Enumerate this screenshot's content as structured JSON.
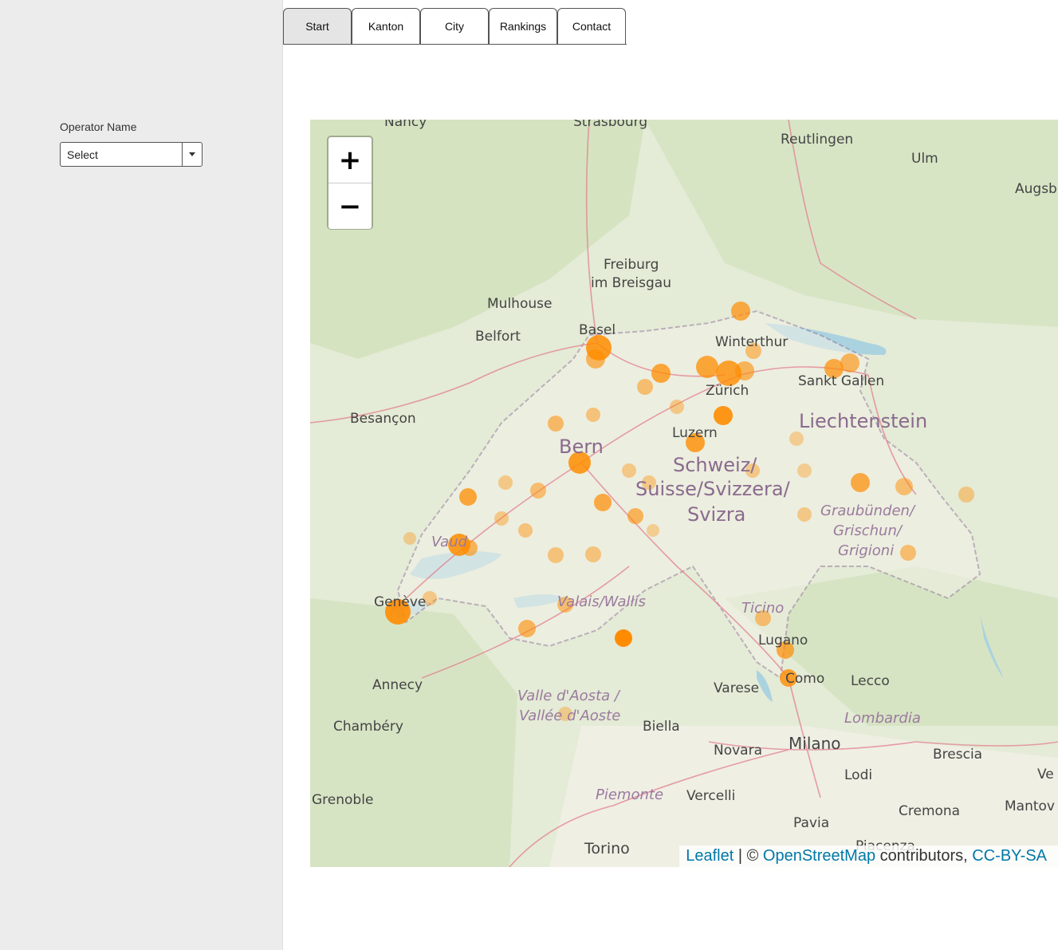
{
  "sidebar": {
    "operator_label": "Operator Name",
    "operator_select_value": "Select"
  },
  "tabs": [
    {
      "label": "Start",
      "active": true
    },
    {
      "label": "Kanton",
      "active": false
    },
    {
      "label": "City",
      "active": false
    },
    {
      "label": "Rankings",
      "active": false
    },
    {
      "label": "Contact",
      "active": false
    }
  ],
  "map": {
    "zoom_in": "+",
    "zoom_out": "−",
    "attribution": {
      "leaflet": "Leaflet",
      "sep": " | © ",
      "osm": "OpenStreetMap",
      "contributors": " contributors, ",
      "license": "CC-BY-SA"
    },
    "marker_color": "#ff8c00",
    "labels": {
      "nancy": "Nancy",
      "strasbourg": "Strasbourg",
      "reutlingen": "Reutlingen",
      "ulm": "Ulm",
      "augsburg": "Augsb",
      "freiburg1": "Freiburg",
      "freiburg2": "im Breisgau",
      "mulhouse": "Mulhouse",
      "belfort": "Belfort",
      "basel": "Basel",
      "winterthur": "Winterthur",
      "sanktgallen": "Sankt Gallen",
      "zurich": "Zürich",
      "besancon": "Besançon",
      "liechtenstein": "Liechtenstein",
      "luzern": "Luzern",
      "bern": "Bern",
      "ch1": "Schweiz/",
      "ch2": "Suisse/Svizzera/",
      "ch3": "Svizra",
      "gr1": "Graubünden/",
      "gr2": "Grischun/",
      "gr3": "Grigioni",
      "vaud": "Vaud",
      "geneve": "Genève",
      "valais": "Valais/Wallis",
      "ticino": "Ticino",
      "lugano": "Lugano",
      "como": "Como",
      "lecco": "Lecco",
      "varese": "Varese",
      "annecy": "Annecy",
      "aosta1": "Valle d'Aosta /",
      "aosta2": "Vallée d'Aoste",
      "biella": "Biella",
      "chambery": "Chambéry",
      "lombardia": "Lombardia",
      "novara": "Novara",
      "milano": "Milano",
      "brescia": "Brescia",
      "grenoble": "Grenoble",
      "lodi": "Lodi",
      "ver": "Ve",
      "piemonte": "Piemonte",
      "vercelli": "Vercelli",
      "cremona": "Cremona",
      "mantova": "Mantov",
      "pavia": "Pavia",
      "torino": "Torino",
      "piacenza": "Piacenza"
    }
  }
}
